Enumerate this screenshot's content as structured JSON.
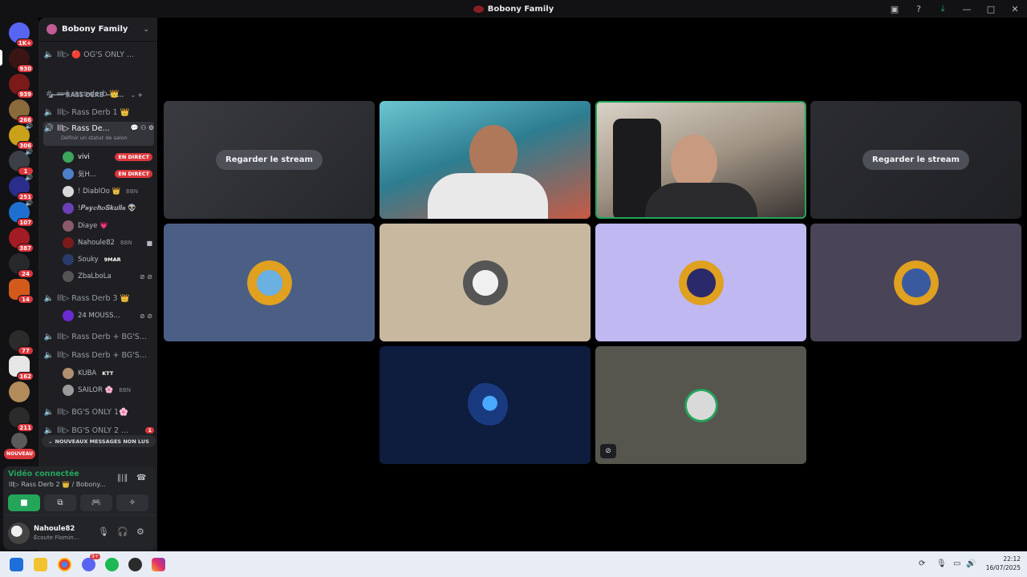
{
  "window": {
    "title": "Bobony Family"
  },
  "rail": {
    "home_badge": "1K+",
    "badges": [
      "930",
      "939",
      "266",
      "306",
      "1",
      "251",
      "107",
      "387",
      "24",
      "14",
      "77",
      "162",
      "211"
    ],
    "new_label": "NOUVEAU"
  },
  "guild": {
    "name": "Bobony Family",
    "channels": [
      {
        "label": "lll▷ 🔴 OG'S ONLY ..."
      },
      {
        "label": "◢━━━ RASS DERB ━━━..."
      },
      {
        "label": "══| rass-derb 👑"
      },
      {
        "label": "lll▷ Rass Derb 1 👑"
      },
      {
        "label": "lll▷ Rass De...",
        "status": "Définir un statut de salon"
      },
      {
        "label": "lll▷ Rass Derb 3 👑"
      },
      {
        "label": "lll▷ Rass Derb + BG'S..."
      },
      {
        "label": "lll▷ Rass Derb + BG'S..."
      },
      {
        "label": "lll▷ BG'S ONLY 1🌸"
      },
      {
        "label": "lll▷ BG'S ONLY 2 ...",
        "badge": "1"
      }
    ],
    "users": [
      {
        "name": "vivi",
        "live": "EN DIRECT"
      },
      {
        "name": "気H...",
        "live": "EN DIRECT"
      },
      {
        "name": "! DiablOo 👑",
        "tag": "BBN"
      },
      {
        "name": "!𝑷𝒔𝒚𝒄𝒉𝒐𝑺𝒌𝒖𝒍𝒍𝒔 👽"
      },
      {
        "name": "Diaye 💗"
      },
      {
        "name": "Nahoule82",
        "tag": "BBN"
      },
      {
        "name": "Souky",
        "tag": "9MAR"
      },
      {
        "name": "ZbaLboLa"
      },
      {
        "name": "24 MOUSS..."
      },
      {
        "name": "KUBA",
        "tag": "KTT"
      },
      {
        "name": "SAILOR 🌸",
        "tag": "BBN"
      }
    ],
    "new_messages": "NOUVEAUX MESSAGES NON LUS"
  },
  "voice": {
    "status": "Vidéo connectée",
    "location": "lll▷ Rass Derb 2 👑 / Bobony..."
  },
  "user": {
    "name": "Nahoule82",
    "activity": "Écoute Flomin..."
  },
  "stage": {
    "stream_button": "Regarder le stream"
  },
  "taskbar": {
    "time": "22:12",
    "date": "16/07/2025",
    "discord_badge": "9+"
  },
  "colors": {
    "accent_green": "#23a55a",
    "live_red": "#da373c",
    "sidebar": "#1f1f23"
  }
}
